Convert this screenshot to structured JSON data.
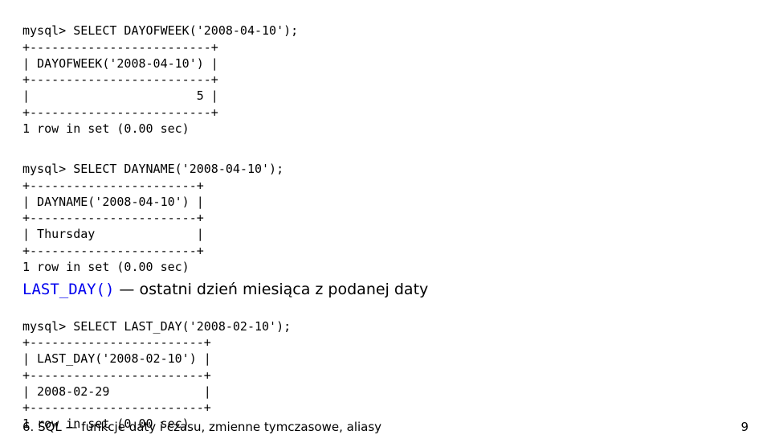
{
  "block1": {
    "l1": "mysql> SELECT DAYOFWEEK('2008-04-10');",
    "l2": "+-------------------------+",
    "l3": "| DAYOFWEEK('2008-04-10') |",
    "l4": "+-------------------------+",
    "l5": "|                       5 |",
    "l6": "+-------------------------+",
    "l7": "1 row in set (0.00 sec)"
  },
  "block2": {
    "l1": "mysql> SELECT DAYNAME('2008-04-10');",
    "l2": "+-----------------------+",
    "l3": "| DAYNAME('2008-04-10') |",
    "l4": "+-----------------------+",
    "l5": "| Thursday              |",
    "l6": "+-----------------------+",
    "l7": "1 row in set (0.00 sec)"
  },
  "desc": {
    "func": "LAST_DAY()",
    "sep": " — ",
    "text": "ostatni dzień miesiąca z podanej daty"
  },
  "block3": {
    "l1": "mysql> SELECT LAST_DAY('2008-02-10');",
    "l2": "+------------------------+",
    "l3": "| LAST_DAY('2008-02-10') |",
    "l4": "+------------------------+",
    "l5": "| 2008-02-29             |",
    "l6": "+------------------------+",
    "l7": "1 row in set (0.00 sec)"
  },
  "footer": {
    "left": "6. SQL — funkcje daty i czasu, zmienne tymczasowe, aliasy",
    "right": "9"
  }
}
